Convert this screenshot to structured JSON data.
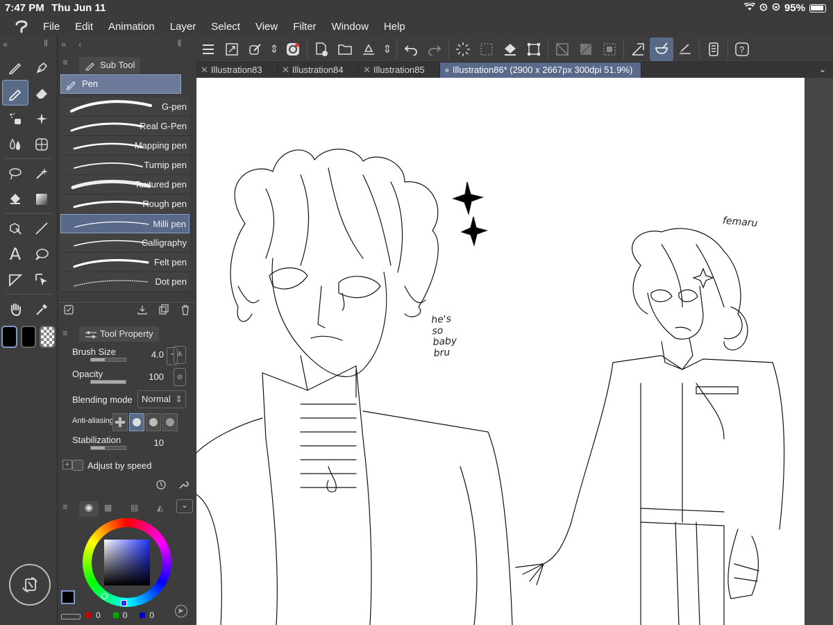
{
  "status_bar": {
    "time": "7:47 PM",
    "date": "Thu Jun 11",
    "battery": "95%"
  },
  "menu": [
    "File",
    "Edit",
    "Animation",
    "Layer",
    "Select",
    "View",
    "Filter",
    "Window",
    "Help"
  ],
  "sub_tool": {
    "panel_title": "Sub Tool",
    "category": "Pen",
    "brushes": [
      "G-pen",
      "Real G-Pen",
      "Mapping pen",
      "Turnip pen",
      "Textured pen",
      "Rough pen",
      "Milli pen",
      "Calligraphy",
      "Felt pen",
      "Dot pen"
    ],
    "selected_index": 6
  },
  "tool_property": {
    "panel_title": "Tool Property",
    "brush_size_label": "Brush Size",
    "brush_size_value": "4.0",
    "brush_size_fraction": 0.4,
    "opacity_label": "Opacity",
    "opacity_value": "100",
    "opacity_fraction": 1.0,
    "blending_label": "Blending mode",
    "blending_value": "Normal",
    "antialias_label": "Anti-aliasing",
    "stabilization_label": "Stabilization",
    "stabilization_value": "10",
    "stabilization_fraction": 0.4,
    "adjust_label": "Adjust by speed"
  },
  "color": {
    "r": "0",
    "g": "0",
    "b": "0",
    "main": "#000000",
    "hue_square_color": "#2030ff"
  },
  "doc_tabs": [
    {
      "label": "Illustration83",
      "active": false
    },
    {
      "label": "Illustration84",
      "active": false
    },
    {
      "label": "Illustration85",
      "active": false
    },
    {
      "label": "Illustration86* (2900 x 2667px 300dpi 51.9%)",
      "active": true
    }
  ],
  "canvas_notes": {
    "left_note": "he's\nso\nbaby\nbru",
    "right_name": "femaru"
  },
  "colors": {
    "accent": "#596a87",
    "panel": "#3d3d3d",
    "canvas": "#ffffff"
  }
}
